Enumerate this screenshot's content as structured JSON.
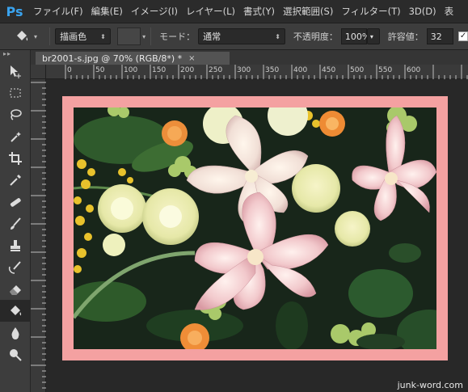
{
  "app": {
    "logo": "Ps"
  },
  "menu": [
    "ファイル(F)",
    "編集(E)",
    "イメージ(I)",
    "レイヤー(L)",
    "書式(Y)",
    "選択範囲(S)",
    "フィルター(T)",
    "3D(D)",
    "表"
  ],
  "options": {
    "tool_icon": "paint-bucket-icon",
    "fill_source": "描画色",
    "mode_label": "モード：",
    "mode_value": "通常",
    "opacity_label": "不透明度：",
    "opacity_value": "100%",
    "tolerance_label": "許容値：",
    "tolerance_value": "32",
    "antialias_checked": "✓"
  },
  "document": {
    "tab_title": "br2001-s.jpg @ 70% (RGB/8*) *",
    "close": "×"
  },
  "ruler": {
    "ticks": [
      "0",
      "50",
      "100",
      "150",
      "200",
      "250",
      "300",
      "350",
      "400",
      "450",
      "500",
      "550",
      "600"
    ]
  },
  "tools": [
    "move-icon",
    "marquee-icon",
    "lasso-icon",
    "magic-wand-icon",
    "crop-icon",
    "eyedropper-icon",
    "healing-icon",
    "brush-icon",
    "stamp-icon",
    "history-brush-icon",
    "eraser-icon",
    "paint-bucket-icon",
    "blur-icon",
    "dodge-icon"
  ],
  "watermark": "junk-word.com",
  "colors": {
    "frame": "#f4a1a1",
    "accent": "#3aa3ee"
  }
}
